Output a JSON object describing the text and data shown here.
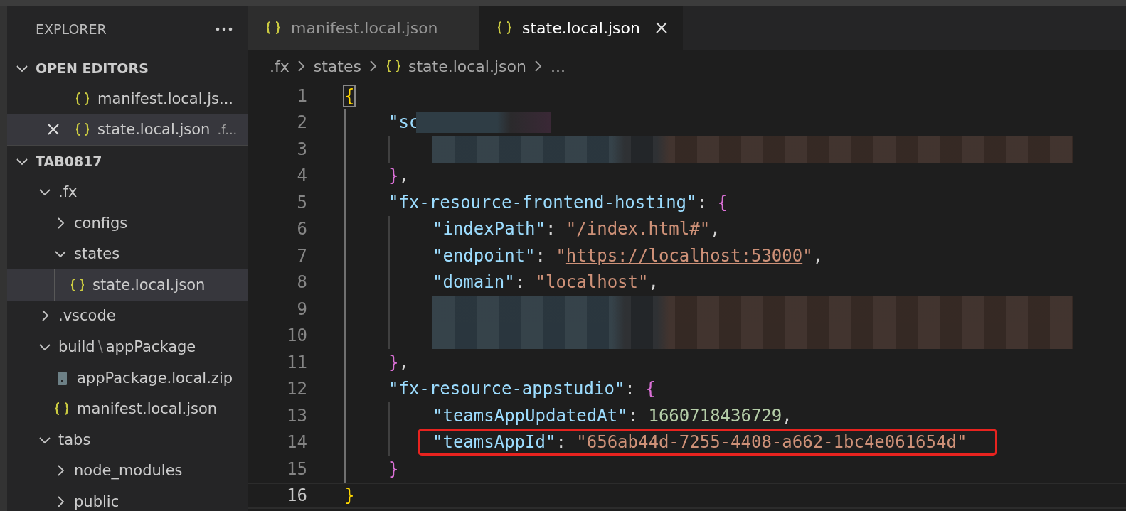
{
  "tabs": [
    {
      "label": "manifest.local.json",
      "kind": "json",
      "selected": false
    },
    {
      "label": "state.local.json",
      "kind": "json",
      "selected": true
    }
  ],
  "breadcrumb": [
    {
      "label": ".fx",
      "kind": "folder"
    },
    {
      "label": "states",
      "kind": "folder"
    },
    {
      "label": "state.local.json",
      "kind": "json"
    },
    {
      "label": "...",
      "kind": "more"
    }
  ],
  "sidebar": {
    "title": "EXPLORER",
    "sections": [
      {
        "label": "OPEN EDITORS",
        "expanded": true,
        "items": [
          {
            "label": "manifest.local.js...",
            "kind": "json",
            "selected": false,
            "closable": false
          },
          {
            "label": "state.local.json",
            "description": ".f...",
            "kind": "json",
            "selected": true,
            "closable": true
          }
        ]
      },
      {
        "label": "TAB0817",
        "expanded": true,
        "tree": [
          {
            "kind": "folder",
            "label": ".fx",
            "expanded": true,
            "selected": false,
            "children": [
              {
                "kind": "folder",
                "label": "configs",
                "expanded": false,
                "selected": false
              },
              {
                "kind": "folder",
                "label": "states",
                "expanded": true,
                "selected": false,
                "children": [
                  {
                    "kind": "json",
                    "label": "state.local.json",
                    "selected": true
                  }
                ]
              }
            ]
          },
          {
            "kind": "folder",
            "label": ".vscode",
            "expanded": false,
            "selected": false
          },
          {
            "kind": "folder",
            "label": "build",
            "separator": "\\",
            "label2": "appPackage",
            "expanded": true,
            "selected": false,
            "children": [
              {
                "kind": "zip",
                "label": "appPackage.local.zip",
                "selected": false
              },
              {
                "kind": "json",
                "label": "manifest.local.json",
                "selected": false
              }
            ]
          },
          {
            "kind": "folder",
            "label": "tabs",
            "expanded": true,
            "selected": false,
            "children": [
              {
                "kind": "folder",
                "label": "node_modules",
                "expanded": false,
                "selected": false
              },
              {
                "kind": "folder",
                "label": "public",
                "expanded": false,
                "selected": false
              }
            ]
          }
        ]
      }
    ]
  },
  "editor": {
    "lines": [
      {
        "number": "1",
        "tokens": [
          {
            "kind": "brace1",
            "text": "{",
            "matched": true
          }
        ],
        "children": [
          {
            "number": "2",
            "tokens": [
              {
                "kind": "key",
                "text": "\"sc"
              },
              {
                "kind": "blur"
              }
            ],
            "children": [
              {
                "number": "3",
                "tokens": [
                  {
                    "kind": "blur"
                  }
                ]
              }
            ]
          },
          {
            "number": "4",
            "tokens": [
              {
                "kind": "brace2",
                "text": "}"
              },
              {
                "kind": "punct",
                "text": ","
              }
            ]
          },
          {
            "number": "5",
            "tokens": [
              {
                "kind": "key",
                "text": "\"fx-resource-frontend-hosting\""
              },
              {
                "kind": "punct",
                "text": ": "
              },
              {
                "kind": "brace2",
                "text": "{"
              }
            ],
            "children": [
              {
                "number": "6",
                "tokens": [
                  {
                    "kind": "key",
                    "text": "\"indexPath\""
                  },
                  {
                    "kind": "punct",
                    "text": ": "
                  },
                  {
                    "kind": "string",
                    "text": "\"/index.html#\""
                  },
                  {
                    "kind": "punct",
                    "text": ","
                  }
                ]
              },
              {
                "number": "7",
                "tokens": [
                  {
                    "kind": "key",
                    "text": "\"endpoint\""
                  },
                  {
                    "kind": "punct",
                    "text": ": "
                  },
                  {
                    "kind": "string",
                    "text": "\""
                  },
                  {
                    "kind": "link",
                    "text": "https://localhost:53000"
                  },
                  {
                    "kind": "string",
                    "text": "\""
                  },
                  {
                    "kind": "punct",
                    "text": ","
                  }
                ]
              },
              {
                "number": "8",
                "tokens": [
                  {
                    "kind": "key",
                    "text": "\"domain\""
                  },
                  {
                    "kind": "punct",
                    "text": ": "
                  },
                  {
                    "kind": "string",
                    "text": "\"localhost\""
                  },
                  {
                    "kind": "punct",
                    "text": ","
                  }
                ]
              },
              {
                "number": "9",
                "tokens": [
                  {
                    "kind": "blur"
                  }
                ]
              },
              {
                "number": "10",
                "tokens": [
                  {
                    "kind": "blur"
                  }
                ]
              }
            ]
          },
          {
            "number": "11",
            "tokens": [
              {
                "kind": "brace2",
                "text": "}"
              },
              {
                "kind": "punct",
                "text": ","
              }
            ]
          },
          {
            "number": "12",
            "tokens": [
              {
                "kind": "key",
                "text": "\"fx-resource-appstudio\""
              },
              {
                "kind": "punct",
                "text": ": "
              },
              {
                "kind": "brace2",
                "text": "{"
              }
            ],
            "children": [
              {
                "number": "13",
                "tokens": [
                  {
                    "kind": "key",
                    "text": "\"teamsAppUpdatedAt\""
                  },
                  {
                    "kind": "punct",
                    "text": ": "
                  },
                  {
                    "kind": "number",
                    "text": "1660718436729"
                  },
                  {
                    "kind": "punct",
                    "text": ","
                  }
                ]
              },
              {
                "number": "14",
                "highlighted": true,
                "tokens": [
                  {
                    "kind": "key",
                    "text": "\"teamsAppId\""
                  },
                  {
                    "kind": "punct",
                    "text": ": "
                  },
                  {
                    "kind": "string",
                    "text": "\"656ab44d-7255-4408-a662-1bc4e061654d\""
                  }
                ]
              }
            ]
          },
          {
            "number": "15",
            "tokens": [
              {
                "kind": "brace2",
                "text": "}"
              }
            ]
          }
        ]
      },
      {
        "number": "16",
        "current": true,
        "tokens": [
          {
            "kind": "brace1",
            "text": "}"
          }
        ]
      }
    ]
  }
}
